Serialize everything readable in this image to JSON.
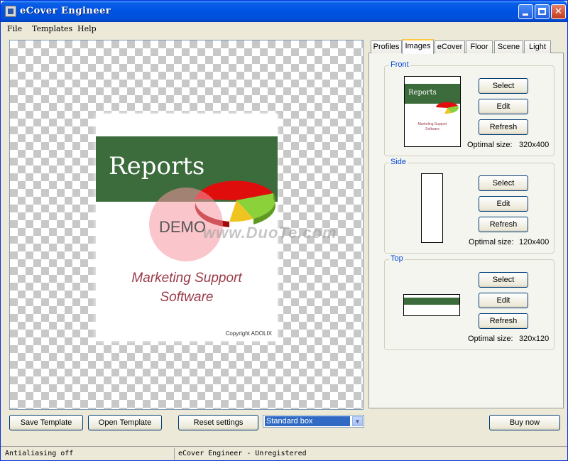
{
  "window": {
    "title": "eCover Engineer"
  },
  "menu": {
    "file": "File",
    "templates": "Templates",
    "help": "Help"
  },
  "preview": {
    "cover_title": "Reports",
    "cover_subtitle_1": "Marketing Support",
    "cover_subtitle_2": "Software",
    "copyright": "Copyright ADOLIX",
    "demo_text": "DEMO",
    "watermark": "www.DuoTe.com"
  },
  "tabs": [
    "Profiles",
    "Images",
    "eCover",
    "Floor",
    "Scene",
    "Light"
  ],
  "images_tab": {
    "front": {
      "label": "Front",
      "select": "Select",
      "edit": "Edit",
      "refresh": "Refresh",
      "optimal_label": "Optimal size:",
      "optimal_value": "320x400"
    },
    "side": {
      "label": "Side",
      "select": "Select",
      "edit": "Edit",
      "refresh": "Refresh",
      "optimal_label": "Optimal size:",
      "optimal_value": "120x400"
    },
    "top": {
      "label": "Top",
      "select": "Select",
      "edit": "Edit",
      "refresh": "Refresh",
      "optimal_label": "Optimal size:",
      "optimal_value": "320x120"
    }
  },
  "bottom": {
    "save_template": "Save Template",
    "open_template": "Open Template",
    "reset_settings": "Reset settings",
    "box_type": "Standard box",
    "buy_now": "Buy now"
  },
  "status": {
    "left": "Antialiasing off",
    "center": "eCover Engineer - Unregistered"
  },
  "colors": {
    "cover_band": "#3c6b3c",
    "accent_red": "#9a3a48",
    "titlebar": "#0054e3"
  }
}
